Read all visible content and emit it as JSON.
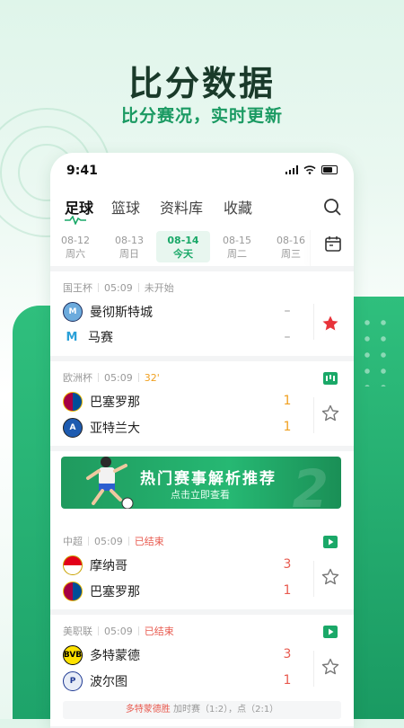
{
  "promo": {
    "headline": "比分数据",
    "subline": "比分赛况，实时更新"
  },
  "status_bar": {
    "time": "9:41"
  },
  "tabs": [
    {
      "label": "足球",
      "active": true
    },
    {
      "label": "篮球",
      "active": false
    },
    {
      "label": "资料库",
      "active": false
    },
    {
      "label": "收藏",
      "active": false
    }
  ],
  "dates": [
    {
      "date": "08-12",
      "weekday": "周六",
      "active": false
    },
    {
      "date": "08-13",
      "weekday": "周日",
      "active": false
    },
    {
      "date": "08-14",
      "weekday": "今天",
      "active": true
    },
    {
      "date": "08-15",
      "weekday": "周二",
      "active": false
    },
    {
      "date": "08-16",
      "weekday": "周三",
      "active": false
    }
  ],
  "matches": [
    {
      "league": "国王杯",
      "time": "05:09",
      "status": "未开始",
      "status_color": "#999999",
      "home": {
        "name": "曼彻斯特城",
        "score": "–"
      },
      "away": {
        "name": "马赛",
        "score": "–"
      },
      "favorite": true,
      "icon": "none"
    },
    {
      "league": "欧洲杯",
      "time": "05:09",
      "status": "32'",
      "status_color": "#f0a020",
      "home": {
        "name": "巴塞罗那",
        "score": "1"
      },
      "away": {
        "name": "亚特兰大",
        "score": "1"
      },
      "favorite": false,
      "icon": "live-stats-icon"
    },
    {
      "league": "中超",
      "time": "05:09",
      "status": "已结束",
      "status_color": "#e85a4f",
      "home": {
        "name": "摩纳哥",
        "score": "3"
      },
      "away": {
        "name": "巴塞罗那",
        "score": "1"
      },
      "favorite": false,
      "icon": "video-icon"
    },
    {
      "league": "美职联",
      "time": "05:09",
      "status": "已结束",
      "status_color": "#e85a4f",
      "home": {
        "name": "多特蒙德",
        "score": "3"
      },
      "away": {
        "name": "波尔图",
        "score": "1"
      },
      "favorite": false,
      "icon": "video-icon",
      "note": {
        "winner": "多特蒙德胜",
        "detail": "加时赛（1:2），点（2:1）"
      }
    }
  ],
  "banner": {
    "title": "热门赛事解析推荐",
    "subtitle": "点击立即查看"
  },
  "colors": {
    "accent": "#1aa868",
    "live": "#f0a020",
    "finished": "#e85a4f",
    "favorite": "#e8333a"
  }
}
